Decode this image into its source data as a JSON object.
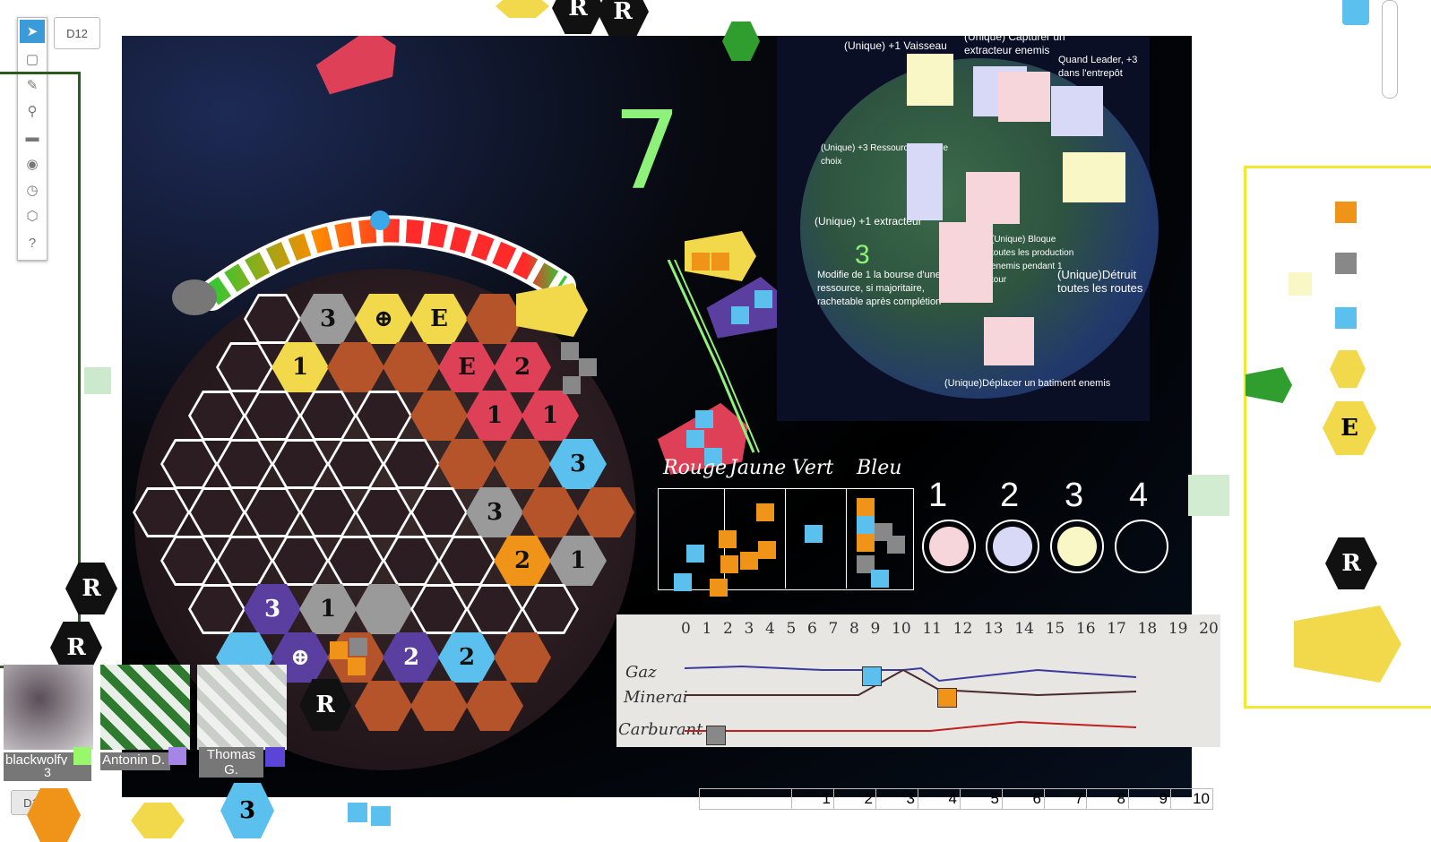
{
  "toolbar": {
    "die_button": "D12",
    "die_button_bottom": "D12",
    "tools": [
      "select-icon",
      "cube-icon",
      "brush-icon",
      "zoom-icon",
      "ruler-icon",
      "eye-icon",
      "clock-icon",
      "dice-icon",
      "help-icon"
    ]
  },
  "board": {
    "handwritten_number": "7",
    "small_handwritten_number": "3",
    "hex_labels": [
      "3",
      "1",
      "E",
      "1",
      "E",
      "2",
      "1",
      "1",
      "3",
      "3",
      "2",
      "1",
      "3",
      "1",
      "2",
      "2",
      "1",
      "R"
    ],
    "track_position": 0.48
  },
  "globe_abilities": [
    "(Unique) +1 Vaisseau",
    "(Unique) Capturer un extracteur enemis",
    "Quand Leader, +3 dans l'entrepôt",
    "(Unique) +3 Ressource de votre choix",
    "(Unique) +1 extracteur",
    "(Unique) Bloque toutes les production enemis pendant 1 tour",
    "Modifie de 1 la bourse d'une ressource, si majoritaire, rachetable après complétion",
    "(Unique)Détruit toutes les routes",
    "(Unique)Déplacer un batiment enemis"
  ],
  "color_table": {
    "headers": [
      "Rouge",
      "Jaune",
      "Vert",
      "Bleu"
    ]
  },
  "rank_slots": [
    "1",
    "2",
    "3",
    "4"
  ],
  "market": {
    "columns": [
      "0",
      "1",
      "2",
      "3",
      "4",
      "5",
      "6",
      "7",
      "8",
      "9",
      "10",
      "11",
      "12",
      "13",
      "14",
      "15",
      "16",
      "17",
      "18",
      "19",
      "20"
    ],
    "rows": [
      "Gaz",
      "Minerai",
      "Carburant"
    ]
  },
  "players": [
    {
      "name": "blackwolfy",
      "score": "3",
      "color": "#98f76b"
    },
    {
      "name": "Antonin D.",
      "color": "#a585e6"
    },
    {
      "name": "Thomas G.",
      "color": "#5b44d6"
    }
  ],
  "score_table": {
    "columns": [
      "1",
      "2",
      "3",
      "4",
      "5",
      "6",
      "7",
      "8",
      "9",
      "10"
    ]
  },
  "tokens": {
    "r_label": "R",
    "e_label": "E",
    "bottom_hex_label": "3"
  },
  "colors": {
    "accent_yellow": "#f2d94c",
    "board_red": "#de4057",
    "board_blue": "#5cc0ee",
    "board_orange": "#ef9418"
  }
}
